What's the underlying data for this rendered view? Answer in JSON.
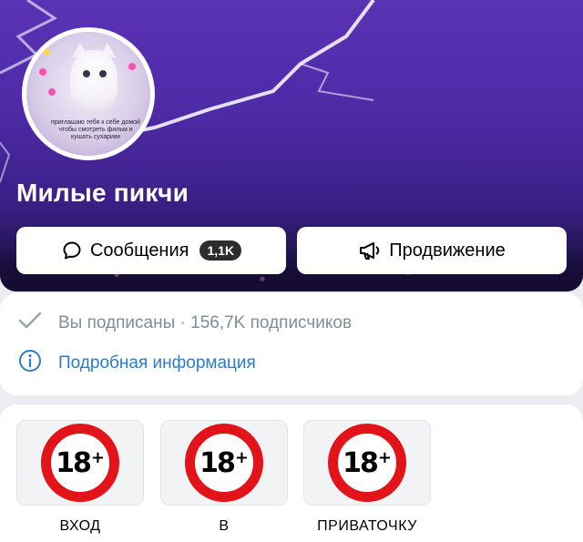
{
  "community": {
    "name": "Милые пикчи",
    "avatar_caption": "приглашаю тебя к себе домой чтобы смотреть фильм и кушать сухарики"
  },
  "actions": {
    "messages_label": "Сообщения",
    "messages_count": "1,1K",
    "promo_label": "Продвижение"
  },
  "info": {
    "subscription_status": "Вы подписаны · 156,7K подписчиков",
    "details_link": "Подробная информация"
  },
  "gallery": {
    "items": [
      {
        "badge_number": "18",
        "badge_plus": "+",
        "label": "ВХОД"
      },
      {
        "badge_number": "18",
        "badge_plus": "+",
        "label": "В"
      },
      {
        "badge_number": "18",
        "badge_plus": "+",
        "label": "ПРИВАТОЧКУ"
      }
    ]
  },
  "colors": {
    "cover_purple": "#4d2aa6",
    "link_blue": "#2a7ccd",
    "muted_gray": "#818c99",
    "badge_dark": "#2c2d2e",
    "sign_red": "#e3131a"
  },
  "icons": {
    "message": "chat-bubble-icon",
    "promo": "megaphone-icon",
    "subscribed": "checkmark-icon",
    "info": "info-circle-icon"
  }
}
